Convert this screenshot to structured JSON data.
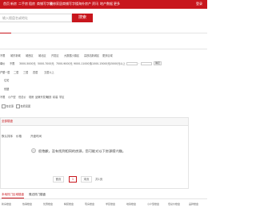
{
  "nav": {
    "items": [
      "首页",
      "新房",
      "二手房",
      "租房",
      "商铺写字楼",
      "装修家居",
      "商铺写字楼",
      "海外房产",
      "资讯",
      "地产数据",
      "更多"
    ],
    "login": "登录"
  },
  "search": {
    "placeholder": "输入楼盘名或地址",
    "button": "搜索"
  },
  "filters": {
    "district": {
      "label": "区域",
      "options": [
        "不限",
        "城东新城",
        "城西区",
        "城北区",
        "开发区",
        "大数据小镇区",
        "高铁站新城区",
        "更多区域"
      ]
    },
    "price": {
      "label": "单价",
      "options": [
        "不限",
        "3000-5000元",
        "5000-7000元",
        "7000-9000元",
        "9000-11000元",
        "11000-15000元",
        "15000元以上"
      ],
      "confirm": "确定"
    },
    "rooms": {
      "label": "户型",
      "options": [
        "不限",
        "一居",
        "二居",
        "三居",
        "四居",
        "五居以上"
      ]
    },
    "type": {
      "label": "类型",
      "options": [
        "住宅",
        "别墅"
      ]
    },
    "feature": {
      "label": "特色",
      "options": [
        "不限",
        "小户型",
        "低总价",
        "现房",
        "品牌开发商",
        "地铁",
        "精装",
        "学区"
      ]
    },
    "extra": {
      "label": "更多",
      "options": [
        "不限",
        "在售",
        "待售",
        "售罄"
      ]
    },
    "checks": [
      "有优惠",
      "有看房团"
    ]
  },
  "results": {
    "tab": "全部楼盘",
    "sort": [
      "默认排序",
      "价格",
      "开盘时间"
    ],
    "empty_message": "很抱歉，没有找到相同的房源，您可能对以下房源感兴趣。"
  },
  "pagination": {
    "prev": "首页",
    "page": "1",
    "next": "末页",
    "total": "共1页"
  },
  "bottom": {
    "tabs": [
      "本地热门区域楼盘",
      "周边热门楼盘"
    ],
    "links": [
      "新房楼盘",
      "热销楼盘",
      "优惠楼盘",
      "精装楼盘",
      "现房楼盘",
      "学区楼盘",
      "地铁楼盘",
      "小户型楼盘",
      "低总价楼盘",
      "品牌楼盘"
    ]
  }
}
